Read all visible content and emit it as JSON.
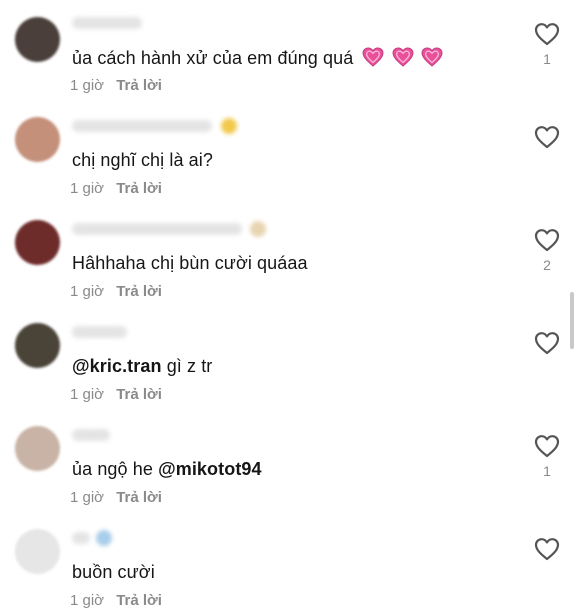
{
  "comments": [
    {
      "text": "ủa cách hành xử của em đúng quá",
      "emoji_after_text": "pink-hearts",
      "emoji_count": 3,
      "time": "1 giờ",
      "reply_label": "Trả lời",
      "likes": "1",
      "avatar_color": "#4a3f3a"
    },
    {
      "text": "chị nghĩ chị là ai?",
      "time": "1 giờ",
      "reply_label": "Trả lời",
      "likes": "",
      "avatar_color": "#c4907a"
    },
    {
      "text": "Hâhhaha chị bùn cười quáaa",
      "time": "1 giờ",
      "reply_label": "Trả lời",
      "likes": "2",
      "avatar_color": "#6d2c2a"
    },
    {
      "mention": "@kric.tran",
      "text_after": " gì z tr",
      "time": "1 giờ",
      "reply_label": "Trả lời",
      "likes": "",
      "avatar_color": "#4a4338"
    },
    {
      "text_before": "ủa ngộ he ",
      "mention": "@mikotot94",
      "time": "1 giờ",
      "reply_label": "Trả lời",
      "likes": "1",
      "avatar_color": "#c9b3a6"
    },
    {
      "text": "buồn cười",
      "time": "1 giờ",
      "reply_label": "Trả lời",
      "likes": "",
      "avatar_color": "#e6e6e6"
    }
  ],
  "colors": {
    "text": "#161616",
    "meta": "#8a8a8a",
    "heart_outline": "#555555",
    "emoji_heart": "#e8509a"
  },
  "icons": {
    "like": "heart-outline-icon"
  }
}
